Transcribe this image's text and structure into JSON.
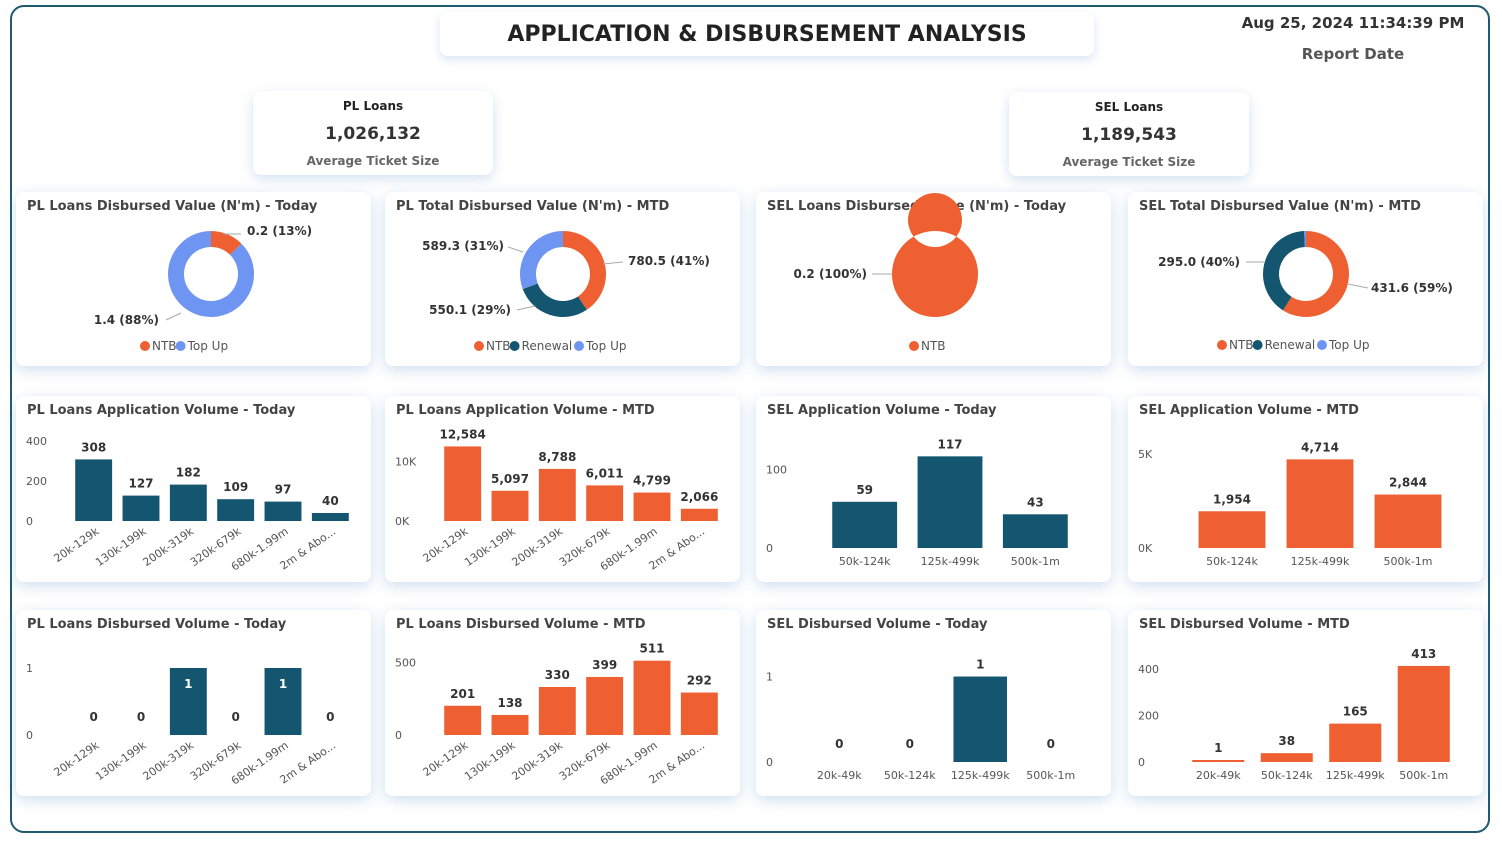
{
  "header": {
    "title": "APPLICATION & DISBURSEMENT ANALYSIS",
    "date": "Aug 25, 2024 11:34:39 PM",
    "date_label": "Report Date"
  },
  "kpis": [
    {
      "title": "PL Loans",
      "value": "1,026,132",
      "label": "Average Ticket Size"
    },
    {
      "title": "SEL Loans",
      "value": "1,189,543",
      "label": "Average Ticket Size"
    }
  ],
  "colors": {
    "NTB": "#ee6031",
    "Renewal": "#14566f",
    "Top Up": "#6f95f2",
    "bar_blue": "#14566f",
    "bar_orange": "#ee6031"
  },
  "chart_data": [
    {
      "type": "pie",
      "title": "PL Loans Disbursed Value (N'm) - Today",
      "slices": [
        {
          "name": "NTB",
          "value": 0.2,
          "label": "0.2 (13%)"
        },
        {
          "name": "Top Up",
          "value": 1.4,
          "label": "1.4 (88%)"
        }
      ],
      "legend": [
        "NTB",
        "Top Up"
      ]
    },
    {
      "type": "pie",
      "title": "PL Total Disbursed Value (N'm) - MTD",
      "slices": [
        {
          "name": "NTB",
          "value": 780.5,
          "label": "780.5 (41%)"
        },
        {
          "name": "Renewal",
          "value": 550.1,
          "label": "550.1 (29%)"
        },
        {
          "name": "Top Up",
          "value": 589.3,
          "label": "589.3 (31%)"
        }
      ],
      "legend": [
        "NTB",
        "Renewal",
        "Top Up"
      ]
    },
    {
      "type": "pie",
      "title": "SEL Loans Disbursed Value (N'm) - Today",
      "slices": [
        {
          "name": "NTB",
          "value": 0.2,
          "label": "0.2 (100%)"
        }
      ],
      "legend": [
        "NTB"
      ]
    },
    {
      "type": "pie",
      "title": "SEL Total Disbursed Value (N'm) - MTD",
      "slices": [
        {
          "name": "NTB",
          "value": 431.6,
          "label": "431.6 (59%)"
        },
        {
          "name": "Renewal",
          "value": 295.0,
          "label": "295.0 (40%)"
        },
        {
          "name": "Top Up",
          "value": 5,
          "label": ""
        }
      ],
      "legend": [
        "NTB",
        "Renewal",
        "Top Up"
      ]
    },
    {
      "type": "bar",
      "title": "PL Loans Application Volume - Today",
      "categories": [
        "20k-129k",
        "130k-199k",
        "200k-319k",
        "320k-679k",
        "680k-1.99m",
        "2m & Abo..."
      ],
      "values": [
        308,
        127,
        182,
        109,
        97,
        40
      ],
      "labels": [
        "308",
        "127",
        "182",
        "109",
        "97",
        "40"
      ],
      "ylim": [
        0,
        400
      ],
      "yticks": [
        "0",
        "200",
        "400"
      ],
      "ytick_values": [
        0,
        200,
        400
      ],
      "color": "bar_blue",
      "rotate": true
    },
    {
      "type": "bar",
      "title": "PL Loans Application Volume - MTD",
      "categories": [
        "20k-129k",
        "130k-199k",
        "200k-319k",
        "320k-679k",
        "680k-1.99m",
        "2m & Abo..."
      ],
      "values": [
        12584,
        5097,
        8788,
        6011,
        4799,
        2066
      ],
      "labels": [
        "12,584",
        "5,097",
        "8,788",
        "6,011",
        "4,799",
        "2,066"
      ],
      "ylim": [
        0,
        13500
      ],
      "yticks": [
        "0K",
        "10K"
      ],
      "ytick_values": [
        0,
        10000
      ],
      "color": "bar_orange",
      "rotate": true
    },
    {
      "type": "bar",
      "title": "SEL Application Volume - Today",
      "categories": [
        "50k-124k",
        "125k-499k",
        "500k-1m"
      ],
      "values": [
        59,
        117,
        43
      ],
      "labels": [
        "59",
        "117",
        "43"
      ],
      "ylim": [
        0,
        120
      ],
      "yticks": [
        "0",
        "100"
      ],
      "ytick_values": [
        0,
        100
      ],
      "color": "bar_blue",
      "rotate": false
    },
    {
      "type": "bar",
      "title": "SEL Application Volume - MTD",
      "categories": [
        "50k-124k",
        "125k-499k",
        "500k-1m"
      ],
      "values": [
        1954,
        4714,
        2844
      ],
      "labels": [
        "1,954",
        "4,714",
        "2,844"
      ],
      "ylim": [
        0,
        5000
      ],
      "yticks": [
        "0K",
        "5K"
      ],
      "ytick_values": [
        0,
        5000
      ],
      "color": "bar_orange",
      "rotate": false
    },
    {
      "type": "bar",
      "title": "PL Loans Disbursed Volume - Today",
      "categories": [
        "20k-129k",
        "130k-199k",
        "200k-319k",
        "320k-679k",
        "680k-1.99m",
        "2m & Abo..."
      ],
      "values": [
        0,
        0,
        1,
        0,
        1,
        0
      ],
      "labels": [
        "0",
        "0",
        "1",
        "0",
        "1",
        "0"
      ],
      "ylim": [
        0,
        1
      ],
      "yticks": [
        "0",
        "1"
      ],
      "ytick_values": [
        0,
        1
      ],
      "color": "bar_blue",
      "rotate": true,
      "inside": true
    },
    {
      "type": "bar",
      "title": "PL Loans Disbursed Volume - MTD",
      "categories": [
        "20k-129k",
        "130k-199k",
        "200k-319k",
        "320k-679k",
        "680k-1.99m",
        "2m & Abo..."
      ],
      "values": [
        201,
        138,
        330,
        399,
        511,
        292
      ],
      "labels": [
        "201",
        "138",
        "330",
        "399",
        "511",
        "292"
      ],
      "ylim": [
        0,
        550
      ],
      "yticks": [
        "0",
        "500"
      ],
      "ytick_values": [
        0,
        500
      ],
      "color": "bar_orange",
      "rotate": true
    },
    {
      "type": "bar",
      "title": "SEL Disbursed Volume - Today",
      "categories": [
        "20k-49k",
        "50k-124k",
        "125k-499k",
        "500k-1m"
      ],
      "values": [
        0,
        0,
        1,
        0
      ],
      "labels": [
        "0",
        "0",
        "1",
        "0"
      ],
      "ylim": [
        0,
        1.1
      ],
      "yticks": [
        "0",
        "1"
      ],
      "ytick_values": [
        0,
        1
      ],
      "color": "bar_blue",
      "rotate": false
    },
    {
      "type": "bar",
      "title": "SEL Disbursed Volume - MTD",
      "categories": [
        "20k-49k",
        "50k-124k",
        "125k-499k",
        "500k-1m"
      ],
      "values": [
        1,
        38,
        165,
        413
      ],
      "labels": [
        "1",
        "38",
        "165",
        "413"
      ],
      "ylim": [
        0,
        460
      ],
      "yticks": [
        "0",
        "200",
        "400"
      ],
      "ytick_values": [
        0,
        200,
        400
      ],
      "color": "bar_orange",
      "rotate": false
    }
  ]
}
